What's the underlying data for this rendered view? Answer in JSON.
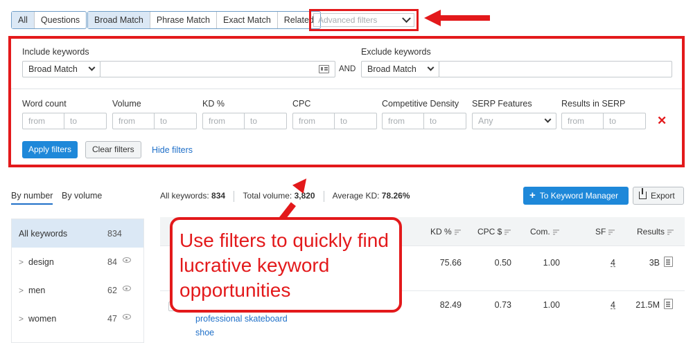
{
  "type_tabs": [
    "All",
    "Questions"
  ],
  "match_tabs": [
    "Broad Match",
    "Phrase Match",
    "Exact Match",
    "Related"
  ],
  "advanced_filters_placeholder": "Advanced filters",
  "filters": {
    "include_label": "Include keywords",
    "include_match": "Broad Match",
    "and_label": "AND",
    "exclude_label": "Exclude keywords",
    "exclude_match": "Broad Match",
    "from_placeholder": "from",
    "to_placeholder": "to",
    "ranges": [
      "Word count",
      "Volume",
      "KD %",
      "CPC",
      "Competitive Density"
    ],
    "serp_label": "SERP Features",
    "serp_value": "Any",
    "results_label": "Results in SERP",
    "apply": "Apply filters",
    "clear": "Clear filters",
    "hide": "Hide filters"
  },
  "view_tabs": [
    "By number",
    "By volume"
  ],
  "sidebar": [
    {
      "name": "All keywords",
      "count": "834"
    },
    {
      "name": "design",
      "count": "84"
    },
    {
      "name": "men",
      "count": "62"
    },
    {
      "name": "women",
      "count": "47"
    }
  ],
  "stats": {
    "all_label": "All keywords:",
    "all_value": "834",
    "volume_label": "Total volume:",
    "volume_value": "3,820",
    "kd_label": "Average KD:",
    "kd_value": "78.26%"
  },
  "keyword_manager_button": "To Keyword Manager",
  "export_button": "Export",
  "columns": [
    "KD %",
    "CPC $",
    "Com.",
    "SF",
    "Results"
  ],
  "rows": [
    {
      "keyword": "",
      "kd": "75.66",
      "cpc": "0.50",
      "com": "1.00",
      "sf": "4",
      "results": "3B"
    },
    {
      "keyword": "professional skateboard shoe",
      "kd": "82.49",
      "cpc": "0.73",
      "com": "1.00",
      "sf": "4",
      "results": "21.5M"
    }
  ],
  "callout_text": "Use filters to quickly find lucrative keyword opportunities",
  "colors": {
    "accent": "#1e88d9",
    "highlight": "#e3191b",
    "link": "#1e6fc8"
  }
}
